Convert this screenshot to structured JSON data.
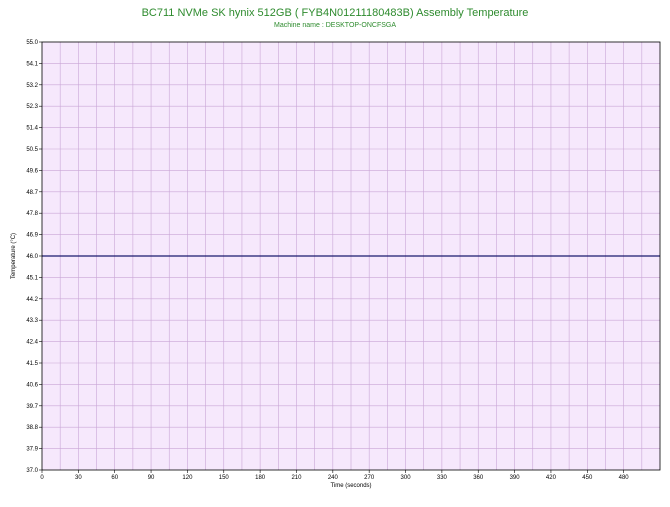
{
  "header": {
    "title": "BC711 NVMe SK hynix 512GB (   FYB4N01211180483B) Assembly Temperature",
    "subtitle": "Machine name : DESKTOP-ONCFSGA"
  },
  "colors": {
    "title": "#2e8b2e",
    "plot_background": "#f6e8fc",
    "grid": "#c9a6d6",
    "series_line": "#1a1a6e",
    "frame": "#000000"
  },
  "chart_data": {
    "type": "line",
    "title": "BC711 NVMe SK hynix 512GB (   FYB4N01211180483B) Assembly Temperature",
    "subtitle": "Machine name : DESKTOP-ONCFSGA",
    "xlabel": "Time (seconds)",
    "ylabel": "Temperature (°C)",
    "xlim": [
      0,
      510
    ],
    "ylim": [
      37.0,
      55.0
    ],
    "x_ticks": [
      0,
      30,
      60,
      90,
      120,
      150,
      180,
      210,
      240,
      270,
      300,
      330,
      360,
      390,
      420,
      450,
      480
    ],
    "x_tick_labels": [
      "0",
      "30",
      "60",
      "90",
      "120",
      "150",
      "180",
      "210",
      "240",
      "270",
      "300",
      "330",
      "360",
      "390",
      "420",
      "450",
      "480"
    ],
    "y_ticks": [
      37.0,
      37.9,
      38.8,
      39.7,
      40.6,
      41.5,
      42.4,
      43.3,
      44.2,
      45.1,
      46.0,
      46.9,
      47.8,
      48.7,
      49.6,
      50.5,
      51.4,
      52.3,
      53.2,
      54.1,
      55.0
    ],
    "y_tick_labels": [
      "37.0",
      "37.9",
      "38.8",
      "39.7",
      "40.6",
      "41.5",
      "42.4",
      "43.3",
      "44.2",
      "45.1",
      "46.0",
      "46.9",
      "47.8",
      "48.7",
      "49.6",
      "50.5",
      "51.4",
      "52.3",
      "53.2",
      "54.1",
      "55.0"
    ],
    "x_minor_step": 15,
    "grid": true,
    "series": [
      {
        "x": [
          0,
          510
        ],
        "values": [
          46.0,
          46.0
        ]
      }
    ]
  }
}
